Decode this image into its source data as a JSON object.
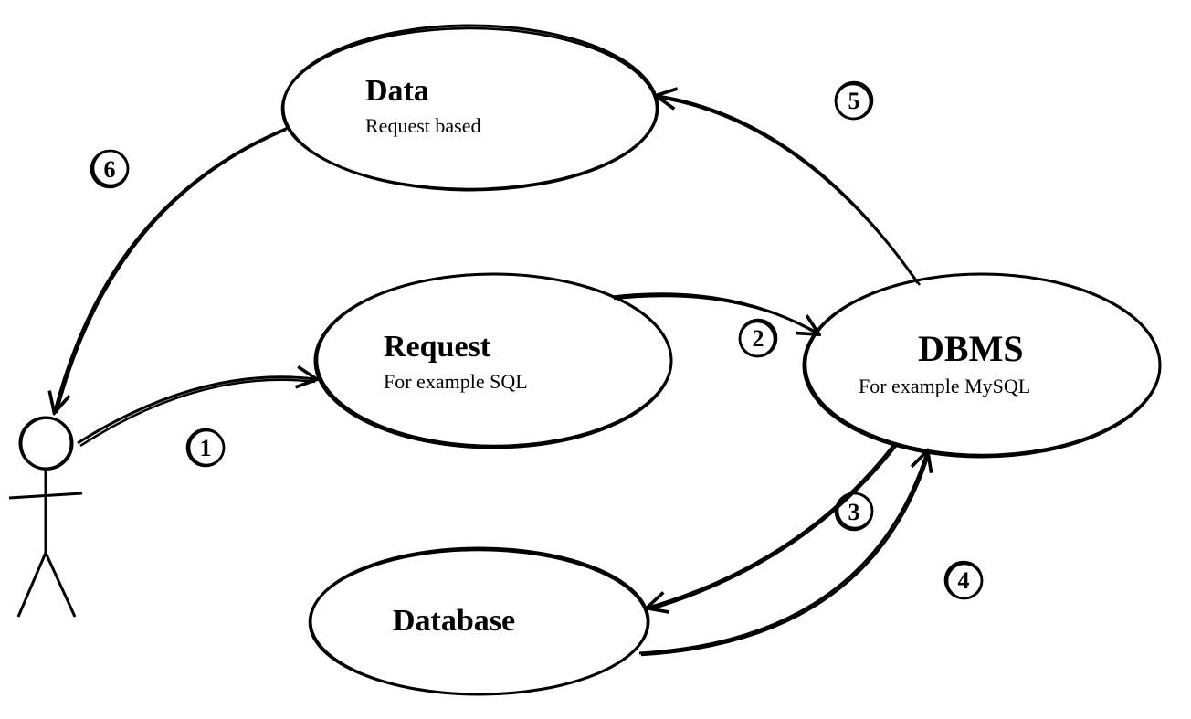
{
  "nodes": {
    "data": {
      "title": "Data",
      "subtitle": "Request based"
    },
    "request": {
      "title": "Request",
      "subtitle": "For example SQL"
    },
    "dbms": {
      "title": "DBMS",
      "subtitle": "For example MySQL"
    },
    "database": {
      "title": "Database",
      "subtitle": ""
    }
  },
  "steps": {
    "s1": "1",
    "s2": "2",
    "s3": "3",
    "s4": "4",
    "s5": "5",
    "s6": "6"
  }
}
